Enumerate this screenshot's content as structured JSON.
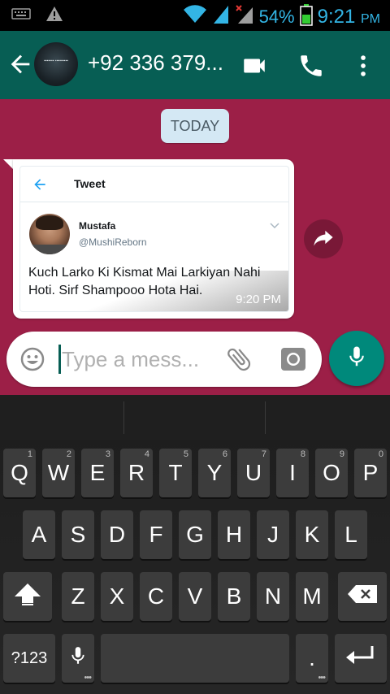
{
  "status_bar": {
    "battery_percent": "54%",
    "time": "9:21",
    "ampm": "PM",
    "icons": [
      "keyboard-icon",
      "warning-icon",
      "wifi-icon",
      "signal-icon",
      "signal-x-icon",
      "battery-icon"
    ]
  },
  "header": {
    "contact_name": "+92 336 379...",
    "back_icon": "arrow-left-icon",
    "video_icon": "videocam-icon",
    "call_icon": "phone-icon",
    "menu_icon": "more-vert-icon"
  },
  "chat": {
    "date_label": "TODAY",
    "message": {
      "tweet_header": "Tweet",
      "user_name": "Mustafa",
      "user_handle": "@MushiReborn",
      "tweet_text": "Kuch Larko Ki Kismat Mai Larkiyan Nahi Hoti. Sirf Shampooo Hota Hai.",
      "time": "9:20 PM"
    }
  },
  "composer": {
    "placeholder": "Type a mess..."
  },
  "keyboard": {
    "row1": [
      {
        "label": "Q",
        "hint": "1"
      },
      {
        "label": "W",
        "hint": "2"
      },
      {
        "label": "E",
        "hint": "3"
      },
      {
        "label": "R",
        "hint": "4"
      },
      {
        "label": "T",
        "hint": "5"
      },
      {
        "label": "Y",
        "hint": "6"
      },
      {
        "label": "U",
        "hint": "7"
      },
      {
        "label": "I",
        "hint": "8"
      },
      {
        "label": "O",
        "hint": "9"
      },
      {
        "label": "P",
        "hint": "0"
      }
    ],
    "row2": [
      "A",
      "S",
      "D",
      "F",
      "G",
      "H",
      "J",
      "K",
      "L"
    ],
    "row3": [
      "Z",
      "X",
      "C",
      "V",
      "B",
      "N",
      "M"
    ],
    "symbols_label": "?123",
    "period_label": "."
  },
  "colors": {
    "header": "#075e54",
    "chat_background": "#9c1f47",
    "fab": "#00897b",
    "status_text": "#33b5e5"
  }
}
